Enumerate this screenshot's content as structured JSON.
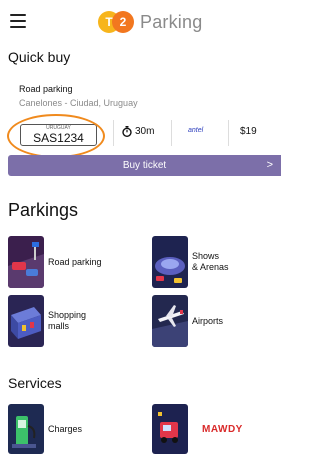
{
  "header": {
    "logo_text_1": "T",
    "logo_text_2": "2",
    "app_name": "Parking"
  },
  "quick_buy": {
    "title": "Quick buy",
    "zone_title": "Road parking",
    "zone_location": "Canelones - Ciudad, Uruguay",
    "plate_country": "URUGUAY",
    "plate_number": "SAS1234",
    "duration": "30m",
    "carrier": "antel",
    "price": "$19",
    "button_label": "Buy ticket",
    "button_chevron": ">"
  },
  "parkings": {
    "title": "Parkings",
    "items": [
      {
        "label": "Road parking"
      },
      {
        "label": "Shows\n& Arenas"
      },
      {
        "label": "Shopping\nmalls"
      },
      {
        "label": "Airports"
      }
    ]
  },
  "services": {
    "title": "Services",
    "items": [
      {
        "label": "Charges"
      },
      {
        "label": "MAWDY"
      }
    ]
  },
  "colors": {
    "accent_purple": "#7c6fa9",
    "highlight_orange": "#f08a1d",
    "logo_yellow": "#f7b51c",
    "logo_orange": "#f2771f",
    "mawdy_red": "#d92a2a"
  }
}
